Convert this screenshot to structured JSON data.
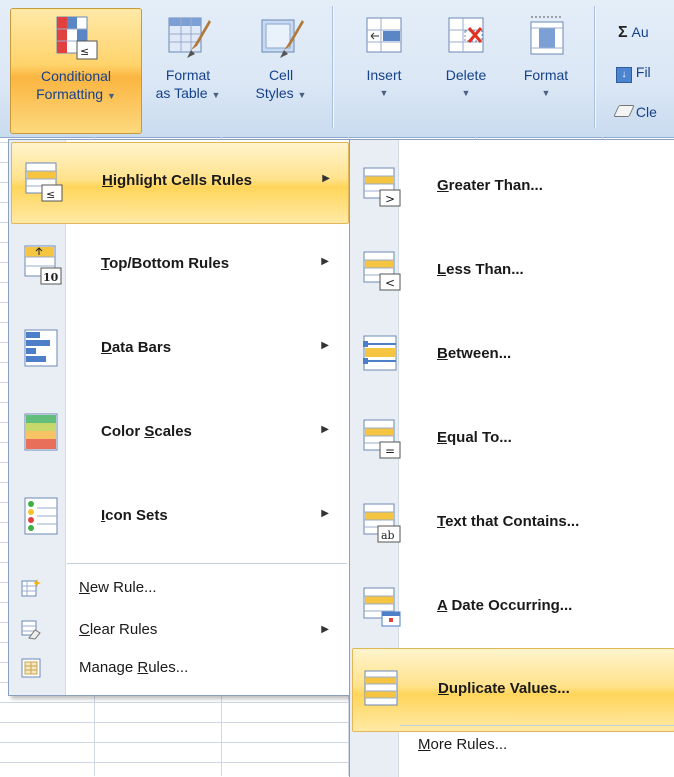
{
  "ribbon": {
    "buttons": [
      {
        "line1": "Conditional",
        "line2": "Formatting",
        "active": true
      },
      {
        "line1": "Format",
        "line2": "as Table"
      },
      {
        "line1": "Cell",
        "line2": "Styles"
      },
      {
        "line1": "Insert",
        "line2": ""
      },
      {
        "line1": "Delete",
        "line2": ""
      },
      {
        "line1": "Format",
        "line2": ""
      }
    ],
    "small_buttons": [
      {
        "label": "Au",
        "icon": "sigma-icon"
      },
      {
        "label": "Fil",
        "icon": "fill-down-icon"
      },
      {
        "label": "Cle",
        "icon": "eraser-icon"
      }
    ]
  },
  "menu": {
    "items": [
      {
        "pre": "",
        "key": "H",
        "post": "ighlight Cells Rules",
        "icon": "highlight-cells-icon",
        "has_submenu": true,
        "highlighted": true
      },
      {
        "pre": "",
        "key": "T",
        "post": "op/Bottom Rules",
        "icon": "top-bottom-icon",
        "has_submenu": true
      },
      {
        "pre": "",
        "key": "D",
        "post": "ata Bars",
        "icon": "data-bars-icon",
        "has_submenu": true
      },
      {
        "pre": "Color ",
        "key": "S",
        "post": "cales",
        "icon": "color-scales-icon",
        "has_submenu": true
      },
      {
        "pre": "",
        "key": "I",
        "post": "con Sets",
        "icon": "icon-sets-icon",
        "has_submenu": true
      }
    ],
    "small_items": [
      {
        "pre": "",
        "key": "N",
        "post": "ew Rule...",
        "icon": "new-rule-icon",
        "has_submenu": false
      },
      {
        "pre": "",
        "key": "C",
        "post": "lear Rules",
        "icon": "clear-rules-icon",
        "has_submenu": true
      },
      {
        "pre": "Manage ",
        "key": "R",
        "post": "ules...",
        "icon": "manage-rules-icon",
        "has_submenu": false
      }
    ]
  },
  "submenu": {
    "items": [
      {
        "pre": "",
        "key": "G",
        "post": "reater Than...",
        "icon": "greater-than-icon"
      },
      {
        "pre": "",
        "key": "L",
        "post": "ess Than...",
        "icon": "less-than-icon"
      },
      {
        "pre": "",
        "key": "B",
        "post": "etween...",
        "icon": "between-icon"
      },
      {
        "pre": "",
        "key": "E",
        "post": "qual To...",
        "icon": "equal-to-icon"
      },
      {
        "pre": "",
        "key": "T",
        "post": "ext that Contains...",
        "icon": "text-contains-icon"
      },
      {
        "pre": "",
        "key": "A",
        "post": " Date Occurring...",
        "icon": "date-occurring-icon"
      },
      {
        "pre": "",
        "key": "D",
        "post": "uplicate Values...",
        "icon": "duplicate-values-icon",
        "highlighted": true
      }
    ],
    "more": {
      "pre": "",
      "key": "M",
      "post": "ore Rules..."
    }
  },
  "colors": {
    "highlight": "#ffd55a",
    "ribbon": "#dbe7f5",
    "text_blue": "#15428b"
  }
}
